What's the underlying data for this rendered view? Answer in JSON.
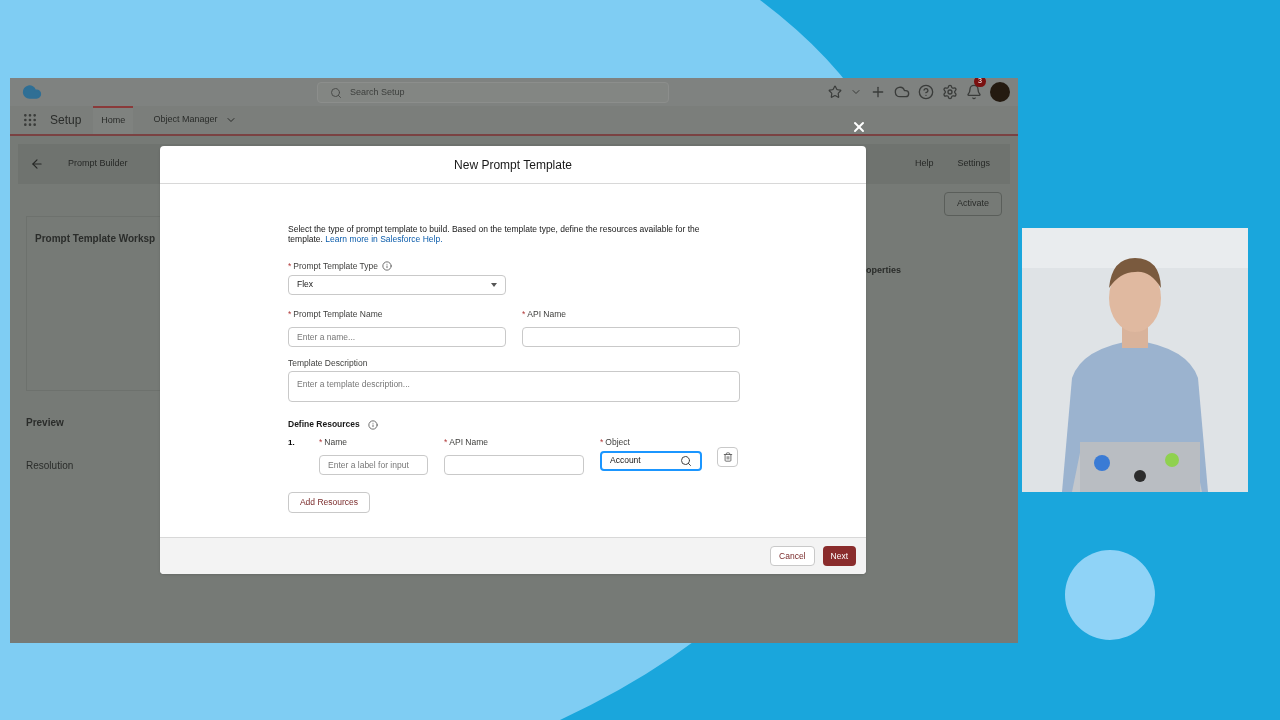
{
  "header": {
    "search_placeholder": "Search Setup",
    "notification_count": "3"
  },
  "nav": {
    "app_name": "Setup",
    "tabs": [
      {
        "label": "Home",
        "selected": true,
        "dropdown": false
      },
      {
        "label": "Object Manager",
        "selected": false,
        "dropdown": true
      }
    ]
  },
  "builder_bar": {
    "title": "Prompt Builder",
    "help": "Help",
    "settings": "Settings",
    "activate": "Activate"
  },
  "background": {
    "workspace_title": "Prompt Template Worksp",
    "preview_title": "Preview",
    "resolution_title": "Resolution",
    "properties_title": "operties"
  },
  "modal": {
    "title": "New Prompt Template",
    "intro": "Select the type of prompt template to build. Based on the template type, define the resources available for the template.",
    "help_link": "Learn more in Salesforce Help.",
    "type_field": {
      "label": "Prompt Template Type",
      "required_mark": "*",
      "value": "Flex"
    },
    "name_field": {
      "label": "Prompt Template Name",
      "required_mark": "*",
      "placeholder": "Enter a name..."
    },
    "api_field": {
      "label": "API Name",
      "required_mark": "*"
    },
    "description_field": {
      "label": "Template Description",
      "placeholder": "Enter a template description..."
    },
    "resources_title": "Define Resources",
    "resources": [
      {
        "number": "1.",
        "name_mark": "*",
        "name_label": "Name",
        "name_placeholder": "Enter a label for input",
        "api_mark": "*",
        "api_label": "API Name",
        "object_mark": "*",
        "object_label": "Object",
        "object_value": "Account"
      }
    ],
    "add_button": "Add Resources",
    "cancel_button": "Cancel",
    "next_button": "Next"
  }
}
